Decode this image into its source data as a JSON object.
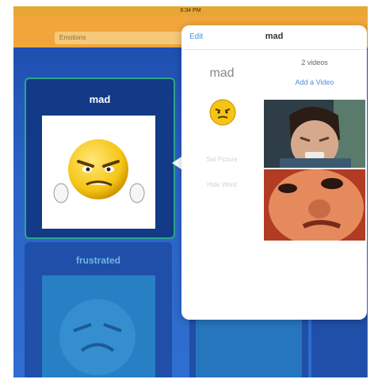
{
  "status": {
    "time": "6:34 PM"
  },
  "nav": {
    "search_value": "Emotions"
  },
  "cards": [
    {
      "label": "mad"
    },
    {
      "label": "frustrated"
    }
  ],
  "popover": {
    "edit_label": "Edit",
    "title": "mad",
    "left_title": "mad",
    "set_picture_label": "Set Picture",
    "hide_word_label": "Hide Word",
    "video_count": "2 videos",
    "add_video_label": "Add a Video",
    "icons": {
      "emotion": "angry-face-icon"
    }
  },
  "colors": {
    "accent": "#4a8fdc",
    "nav": "#f0a63a",
    "background": "#2a62c6"
  }
}
